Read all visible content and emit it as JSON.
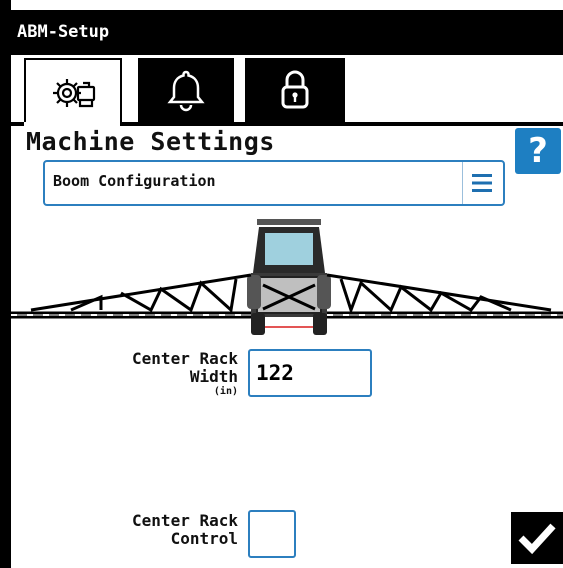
{
  "window": {
    "title": "ABM-Setup"
  },
  "tabs": [
    {
      "icon": "settings-gears-icon",
      "active": true
    },
    {
      "icon": "bell-icon",
      "active": false
    },
    {
      "icon": "lock-icon",
      "active": false
    }
  ],
  "page": {
    "heading": "Machine Settings",
    "help_label": "?"
  },
  "config_select": {
    "value": "Boom Configuration",
    "menu_icon": "hamburger-menu-icon"
  },
  "illustration": {
    "icon": "sprayer-boom-illustration"
  },
  "center_rack_width": {
    "label_line1": "Center Rack",
    "label_line2": "Width",
    "unit": "(in)",
    "value": "122"
  },
  "center_rack_control": {
    "label_line1": "Center Rack",
    "label_line2": "Control",
    "checked": false
  },
  "confirm": {
    "icon": "checkmark-icon"
  },
  "colors": {
    "accent": "#2c7fbf",
    "help_button": "#1e7fc2",
    "title_bar": "#000000"
  }
}
